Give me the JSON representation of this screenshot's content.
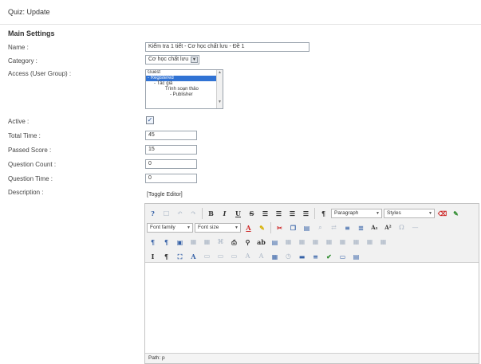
{
  "page": {
    "title": "Quiz: Update"
  },
  "section": {
    "title": "Main Settings"
  },
  "fields": {
    "name_label": "Name :",
    "name_value": "Kiểm tra 1 tiết - Cơ học chất lưu - Đề 1",
    "category_label": "Category :",
    "category_value": "Cơ học chất lưu",
    "access_label": "Access (User Group) :",
    "access_options": [
      "Guest",
      "- Registered",
      "- Tác giả",
      "Trình soạn thảo",
      "- Publisher"
    ],
    "access_selected": "- Registered",
    "active_label": "Active :",
    "active_checked": true,
    "total_time_label": "Total Time :",
    "total_time_value": "45",
    "passed_score_label": "Passed Score :",
    "passed_score_value": "15",
    "question_count_label": "Question Count :",
    "question_count_value": "0",
    "question_time_label": "Question Time :",
    "question_time_value": "0",
    "description_label": "Description :",
    "toggle_editor": "[Toggle Editor]"
  },
  "editor": {
    "paragraph_label": "Paragraph",
    "styles_label": "Styles",
    "font_family_label": "Font family",
    "font_size_label": "Font size",
    "path_label": "Path: p"
  }
}
